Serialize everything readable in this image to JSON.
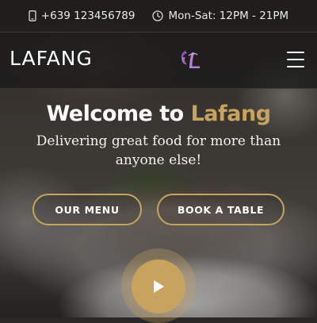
{
  "topbar": {
    "phone": "+639 123456789",
    "hours": "Mon-Sat: 12PM - 21PM",
    "phone_icon": "phone-icon",
    "clock_icon": "clock-icon"
  },
  "navbar": {
    "brand": "LAFANG",
    "logo_icon": "lafang-logo",
    "menu_icon": "hamburger-menu-icon"
  },
  "hero": {
    "welcome_prefix": "Welcome to ",
    "welcome_accent": "Lafang",
    "tagline": "Delivering great food for more than anyone else!",
    "buttons": {
      "menu": "OUR MENU",
      "book": "BOOK A TABLE"
    },
    "play_icon": "play-icon"
  },
  "colors": {
    "accent": "#c8a35f",
    "topbar_bg": "#1e1e1e",
    "navbar_bg": "#191919",
    "logo_purple": "#a86ad0"
  }
}
